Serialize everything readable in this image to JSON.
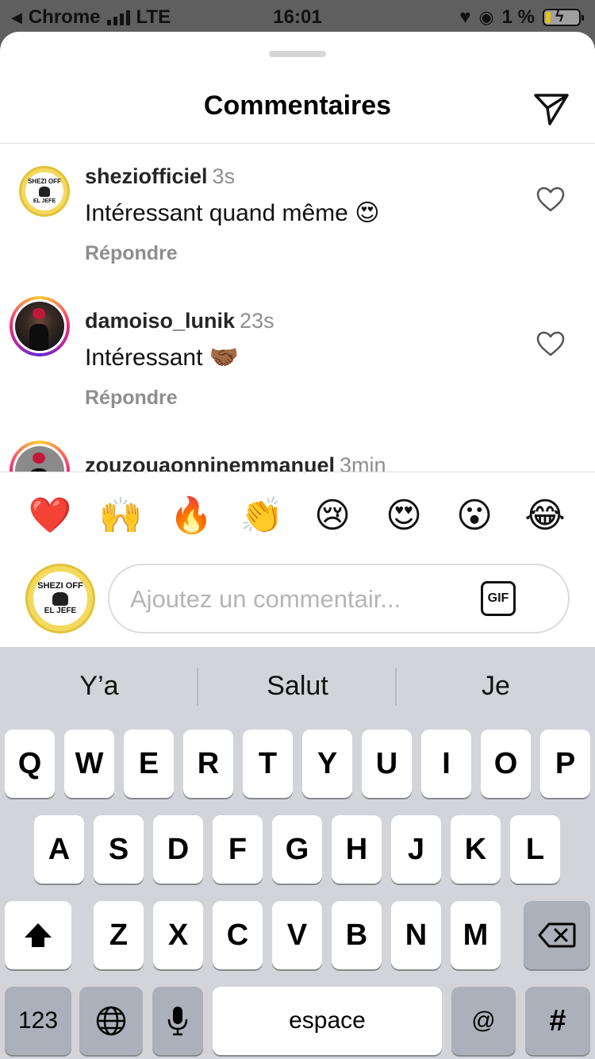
{
  "status_bar": {
    "back_app": "Chrome",
    "network": "LTE",
    "time": "16:01",
    "battery_percent": "1 %",
    "icons": [
      "signal-bars-icon",
      "heart-icon",
      "orientation-lock-icon",
      "battery-charging-icon"
    ]
  },
  "sheet": {
    "title": "Commentaires",
    "send_icon": "paper-plane-icon"
  },
  "comments": [
    {
      "user": "sheziofficiel",
      "time": "3s",
      "text": "Intéressant quand même 😍",
      "reply": "Répondre"
    },
    {
      "user": "damoiso_lunik",
      "time": "23s",
      "text": "Intéressant 🤝🏾",
      "reply": "Répondre"
    },
    {
      "user": "zouzouaonninemmanuel",
      "time": "3min"
    }
  ],
  "logo_text": {
    "top": "SHEZI OFF",
    "bottom": "EL JEFE"
  },
  "emoji_bar": [
    "❤️",
    "🙌",
    "🔥",
    "👏",
    "😢",
    "😍",
    "😮",
    "😂"
  ],
  "composer": {
    "placeholder": "Ajoutez un commentair...",
    "gif_label": "GIF"
  },
  "keyboard": {
    "suggestions": [
      "Y’a",
      "Salut",
      "Je"
    ],
    "row1": [
      "Q",
      "W",
      "E",
      "R",
      "T",
      "Y",
      "U",
      "I",
      "O",
      "P"
    ],
    "row2": [
      "A",
      "S",
      "D",
      "F",
      "G",
      "H",
      "J",
      "K",
      "L"
    ],
    "row3": [
      "Z",
      "X",
      "C",
      "V",
      "B",
      "N",
      "M"
    ],
    "shift_icon": "shift-arrow-icon",
    "backspace_icon": "backspace-icon",
    "numbers_label": "123",
    "globe_icon": "globe-icon",
    "mic_icon": "microphone-icon",
    "space_label": "espace",
    "at_label": "@",
    "hash_label": "#"
  }
}
